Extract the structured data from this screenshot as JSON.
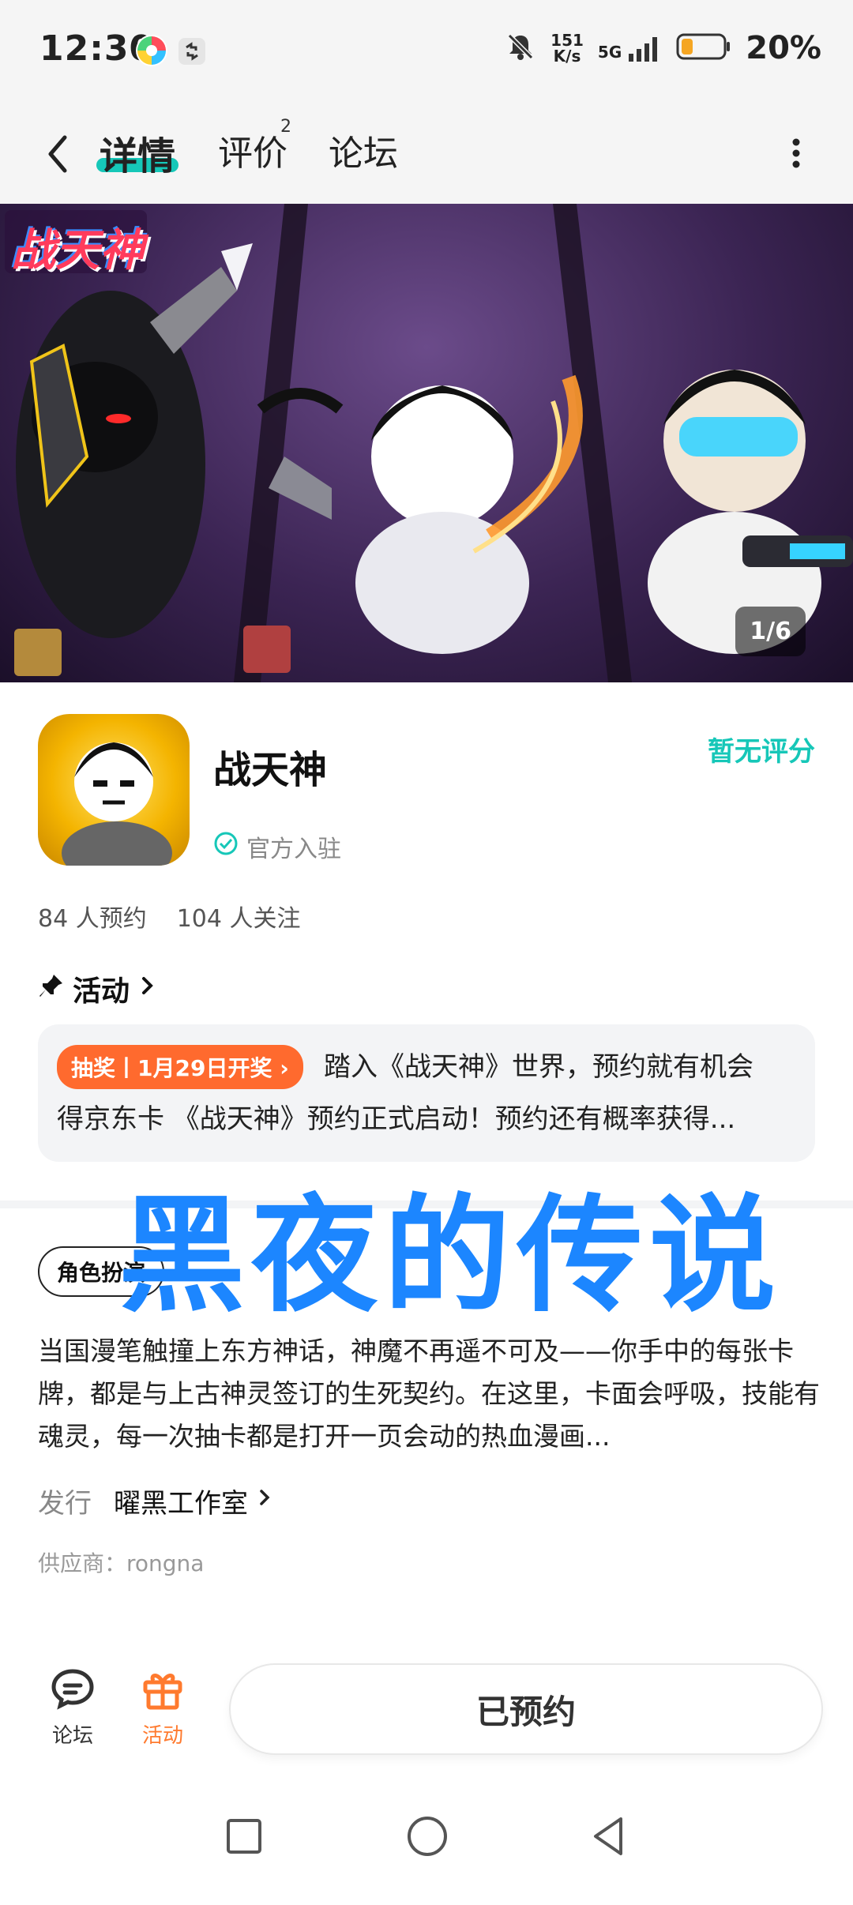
{
  "status_bar": {
    "time": "12:30",
    "net_speed_value": "151",
    "net_speed_unit": "K/s",
    "signal": "5G",
    "battery_percent": "20%"
  },
  "nav": {
    "tabs": [
      "详情",
      "评价",
      "论坛"
    ],
    "review_count": "2"
  },
  "banner": {
    "logo_text": "战天神",
    "counter": "1/6"
  },
  "game": {
    "title": "战天神",
    "official_label": "官方入驻",
    "rating": "暂无评分",
    "reservations": "84 人预约",
    "followers": "104 人关注"
  },
  "activity": {
    "header": "活动",
    "tag": "抽奖丨1月29日开奖 ›",
    "line1": "踏入《战天神》世界，预约就有机会",
    "line2": "得京东卡 《战天神》预约正式启动！预约还有概率获得..."
  },
  "description": {
    "role_tag": "角色扮演",
    "overlay_title": "黑夜的传说",
    "text": "当国漫笔触撞上东方神话，神魔不再遥不可及——你手中的每张卡牌，都是与上古神灵签订的生死契约。在这里，卡面会呼吸，技能有魂灵，每一次抽卡都是打开一页会动的热血漫画...",
    "publisher_label": "发行",
    "publisher_name": "曜黑工作室",
    "supplier": "供应商：rongna"
  },
  "bottom_bar": {
    "forum_label": "论坛",
    "activity_label": "活动",
    "reserved_label": "已预约"
  },
  "colors": {
    "accent": "#16c7b8",
    "orange": "#ff6a2e",
    "overlay_blue": "#1c86ff"
  }
}
